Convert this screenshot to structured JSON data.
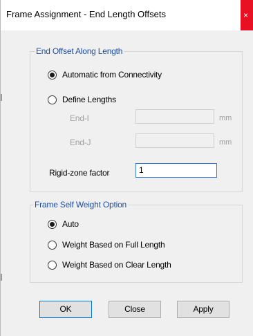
{
  "window": {
    "title": "Frame Assignment - End Length Offsets",
    "close_glyph": "×"
  },
  "end_offset_group": {
    "legend": "End Offset Along Length",
    "option_automatic": "Automatic from Connectivity",
    "option_define": "Define Lengths",
    "selected": "automatic",
    "end_i_label": "End-I",
    "end_i_value": "",
    "end_i_unit": "mm",
    "end_j_label": "End-J",
    "end_j_value": "",
    "end_j_unit": "mm",
    "rigid_zone_label": "Rigid-zone factor",
    "rigid_zone_value": "1"
  },
  "self_weight_group": {
    "legend": "Frame Self Weight Option",
    "option_auto": "Auto",
    "option_full": "Weight Based on Full Length",
    "option_clear": "Weight Based on Clear Length",
    "selected": "auto"
  },
  "buttons": {
    "ok": "OK",
    "close": "Close",
    "apply": "Apply"
  },
  "colors": {
    "group_legend": "#1f4fa3",
    "close_button": "#e81123",
    "active_input_border": "#3478d4"
  }
}
